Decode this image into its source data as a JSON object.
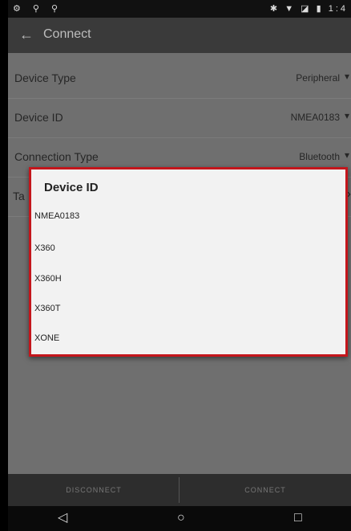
{
  "status_bar": {
    "left_icons": "⚙ ⚲ ⚲",
    "right_text": "✱ ▼ ◪ ▮ 1:4"
  },
  "app_bar": {
    "back_icon": "←",
    "title": "Connect"
  },
  "settings": [
    {
      "label": "Device Type",
      "value": "Peripheral"
    },
    {
      "label": "Device ID",
      "value": "NMEA0183"
    },
    {
      "label": "Connection Type",
      "value": "Bluetooth"
    },
    {
      "label": "Ta"
    }
  ],
  "dialog": {
    "title": "Device ID",
    "options": [
      "NMEA0183",
      "X360",
      "X360H",
      "X360T",
      "XONE"
    ],
    "highlight_color": "#c4161c"
  },
  "bottom_buttons": {
    "disconnect": "DISCONNECT",
    "connect": "CONNECT"
  },
  "nav": {
    "back": "◁",
    "home": "○",
    "recents": "□"
  }
}
